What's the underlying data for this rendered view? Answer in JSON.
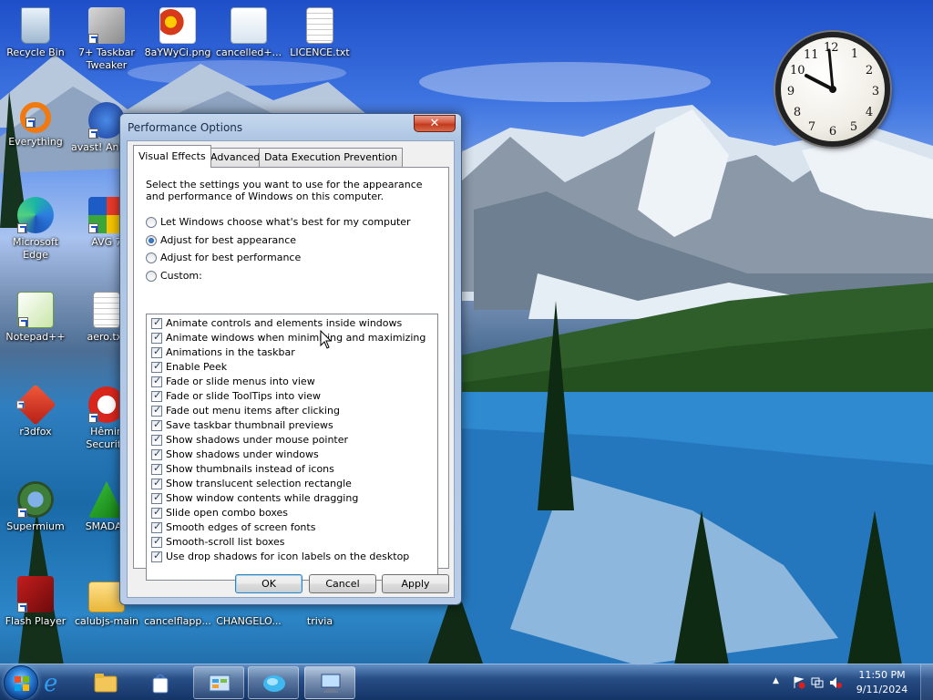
{
  "desktop": {
    "icons": [
      {
        "label": "Recycle Bin",
        "name": "recycle-bin-icon"
      },
      {
        "label": "7+ Taskbar Tweaker",
        "name": "taskbar-tweaker-icon"
      },
      {
        "label": "8aYWyCi.png",
        "name": "png-image-icon"
      },
      {
        "label": "cancelled+...",
        "name": "cancelled-file-icon"
      },
      {
        "label": "LICENCE.txt",
        "name": "text-file-icon"
      },
      {
        "label": "Everything",
        "name": "everything-search-icon"
      },
      {
        "label": "avast! Antivirus",
        "name": "avast-icon"
      },
      {
        "label": "Microsoft Edge",
        "name": "edge-icon"
      },
      {
        "label": "AVG 7",
        "name": "avg-icon"
      },
      {
        "label": "Notepad++",
        "name": "notepad-plus-plus-icon"
      },
      {
        "label": "aero.txt",
        "name": "text-file-icon"
      },
      {
        "label": "r3dfox",
        "name": "r3dfox-icon"
      },
      {
        "label": "Hêmin Security",
        "name": "hemin-security-icon"
      },
      {
        "label": "Supermium",
        "name": "supermium-icon"
      },
      {
        "label": "SMADAV",
        "name": "smadav-icon"
      },
      {
        "label": "Flash Player",
        "name": "flash-player-icon"
      },
      {
        "label": "calubjs-main",
        "name": "folder-icon"
      },
      {
        "label": "cancelflapp...",
        "name": "folder-icon"
      },
      {
        "label": "CHANGELO...",
        "name": "text-file-icon"
      },
      {
        "label": "trivia",
        "name": "folder-icon"
      }
    ]
  },
  "clock_gadget": {
    "numbers": [
      "12",
      "1",
      "2",
      "3",
      "4",
      "5",
      "6",
      "7",
      "8",
      "9",
      "10",
      "11"
    ],
    "time": "11:50"
  },
  "window": {
    "title": "Performance Options",
    "close_label": "✕",
    "tabs": [
      {
        "label": "Visual Effects",
        "active": true
      },
      {
        "label": "Advanced",
        "active": false
      },
      {
        "label": "Data Execution Prevention",
        "active": false
      }
    ],
    "description": "Select the settings you want to use for the appearance and performance of Windows on this computer.",
    "radios": [
      {
        "label": "Let Windows choose what's best for my computer",
        "checked": false
      },
      {
        "label": "Adjust for best appearance",
        "checked": true
      },
      {
        "label": "Adjust for best performance",
        "checked": false
      },
      {
        "label": "Custom:",
        "checked": false
      }
    ],
    "effects": [
      {
        "label": "Animate controls and elements inside windows",
        "checked": true
      },
      {
        "label": "Animate windows when minimizing and maximizing",
        "checked": true
      },
      {
        "label": "Animations in the taskbar",
        "checked": true
      },
      {
        "label": "Enable Peek",
        "checked": true
      },
      {
        "label": "Fade or slide menus into view",
        "checked": true
      },
      {
        "label": "Fade or slide ToolTips into view",
        "checked": true
      },
      {
        "label": "Fade out menu items after clicking",
        "checked": true
      },
      {
        "label": "Save taskbar thumbnail previews",
        "checked": true
      },
      {
        "label": "Show shadows under mouse pointer",
        "checked": true
      },
      {
        "label": "Show shadows under windows",
        "checked": true
      },
      {
        "label": "Show thumbnails instead of icons",
        "checked": true
      },
      {
        "label": "Show translucent selection rectangle",
        "checked": true
      },
      {
        "label": "Show window contents while dragging",
        "checked": true
      },
      {
        "label": "Slide open combo boxes",
        "checked": true
      },
      {
        "label": "Smooth edges of screen fonts",
        "checked": true
      },
      {
        "label": "Smooth-scroll list boxes",
        "checked": true
      },
      {
        "label": "Use drop shadows for icon labels on the desktop",
        "checked": true
      }
    ],
    "buttons": {
      "ok": "OK",
      "cancel": "Cancel",
      "apply": "Apply"
    }
  },
  "taskbar": {
    "start": "start-orb",
    "items": [
      {
        "name": "internet-explorer-icon",
        "running": false
      },
      {
        "name": "file-explorer-icon",
        "running": false
      },
      {
        "name": "store-bag-icon",
        "running": false
      },
      {
        "name": "control-panel-icon",
        "running": true
      },
      {
        "name": "paint-splash-icon",
        "running": true
      },
      {
        "name": "system-properties-icon",
        "running": true
      }
    ],
    "tray": {
      "show_hidden": "▲",
      "time": "11:50 PM",
      "date": "9/11/2024"
    }
  }
}
